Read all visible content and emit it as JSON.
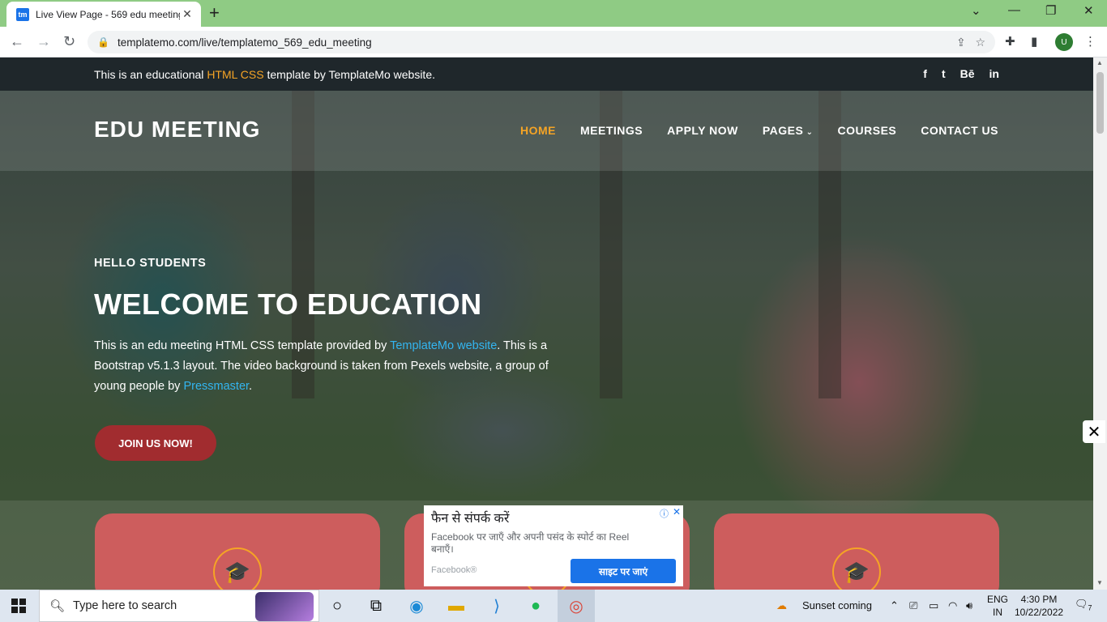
{
  "browser": {
    "tab_title": "Live View Page - 569 edu meeting",
    "tab_favicon": "tm",
    "url": "templatemo.com/live/templatemo_569_edu_meeting",
    "profile_initial": "U"
  },
  "site": {
    "topbar": {
      "text_before": "This is an educational ",
      "highlight": "HTML CSS",
      "text_after": " template by TemplateMo website.",
      "social": [
        "f",
        "t",
        "Bē",
        "in"
      ]
    },
    "logo": "EDU MEETING",
    "menu": [
      "HOME",
      "MEETINGS",
      "APPLY NOW",
      "PAGES",
      "COURSES",
      "CONTACT US"
    ],
    "hero": {
      "subtitle": "HELLO STUDENTS",
      "title": "WELCOME TO EDUCATION",
      "p1": "This is an edu meeting HTML CSS template provided by ",
      "link1": "TemplateMo website",
      "p2": ". This is a Bootstrap v5.1.3 layout. The video background is taken from Pexels website, a group of young people by ",
      "link2": "Pressmaster",
      "p3": ".",
      "button": "JOIN US NOW!"
    }
  },
  "ad": {
    "heading": "फैन से संपर्क करें",
    "body": "Facebook पर जाएँ और अपनी पसंद के स्पोर्ट का Reel बनाएँ।",
    "source": "Facebook®",
    "cta": "साइट पर जाएं"
  },
  "taskbar": {
    "search_placeholder": "Type here to search",
    "weather": "Sunset coming",
    "lang_top": "ENG",
    "lang_bottom": "IN",
    "time": "4:30 PM",
    "date": "10/22/2022",
    "notif_count": "7"
  },
  "colors": {
    "accent": "#f5a425",
    "button": "#a12c2f",
    "card": "#cd5d5d",
    "link": "#33b5f0",
    "tabbar": "#8fcb84"
  }
}
